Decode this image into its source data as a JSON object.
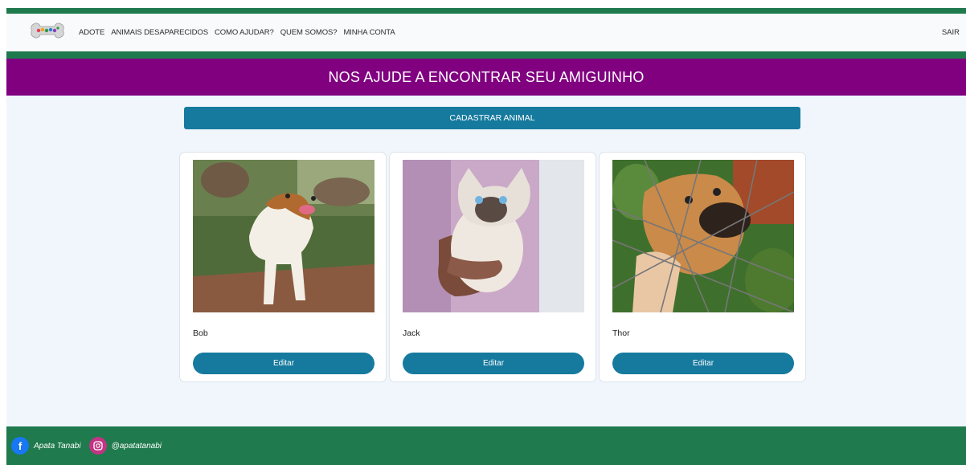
{
  "nav": {
    "items": [
      "ADOTE",
      "ANIMAIS DESAPARECIDOS",
      "COMO AJUDAR?",
      "QUEM SOMOS?",
      "MINHA CONTA"
    ],
    "logout": "SAIR",
    "logo_icon": "apata-bone-logo"
  },
  "banner": {
    "title": "NOS AJUDE A ENCONTRAR SEU AMIGUINHO"
  },
  "actions": {
    "register_label": "CADASTRAR ANIMAL"
  },
  "animals": [
    {
      "name": "Bob",
      "edit_label": "Editar",
      "photo": "dog-photo"
    },
    {
      "name": "Jack",
      "edit_label": "Editar",
      "photo": "cat-photo"
    },
    {
      "name": "Thor",
      "edit_label": "Editar",
      "photo": "dog-fence-photo"
    }
  ],
  "footer": {
    "facebook_icon": "facebook-icon",
    "facebook_name": "Apata Tanabi",
    "instagram_icon": "instagram-icon",
    "instagram_handle": "@apatatanabi"
  },
  "colors": {
    "green": "#1f7a4d",
    "purple": "#800080",
    "button_blue": "#167a9e",
    "background": "#f0f6fb"
  }
}
